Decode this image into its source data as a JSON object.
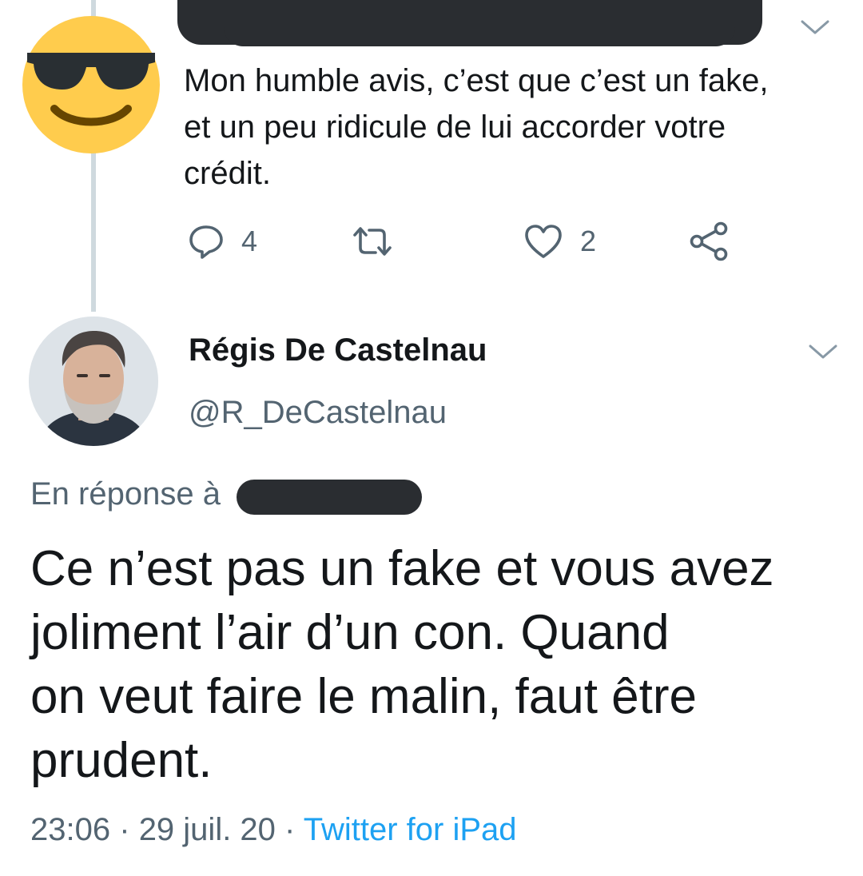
{
  "colors": {
    "text_primary": "#14171a",
    "text_secondary": "#536471",
    "link_blue": "#1da1f2",
    "thread_line": "#cfd9de",
    "redaction": "#2a2d31",
    "emoji_yellow": "#ffcc4d"
  },
  "parent_tweet": {
    "avatar_icon": "sunglasses-emoji-icon",
    "text_lines": [
      "Mon humble avis, c’est que c’est un fake,",
      "et un peu ridicule de lui accorder votre",
      "crédit."
    ],
    "actions": {
      "reply_icon": "reply-bubble-icon",
      "reply_count": "4",
      "retweet_icon": "retweet-icon",
      "like_icon": "heart-icon",
      "like_count": "2",
      "share_icon": "share-icon"
    },
    "menu_icon": "chevron-down-icon"
  },
  "main_tweet": {
    "display_name": "Régis De Castelnau",
    "handle": "@R_DeCastelnau",
    "menu_icon": "chevron-down-icon",
    "in_reply_to_label": "En réponse à",
    "text_lines": [
      "Ce n’est pas un fake et vous avez",
      "joliment l’air d’un con. Quand",
      "on veut faire le malin, faut être",
      "prudent."
    ],
    "time": "23:06",
    "separator": "·",
    "date": "29 juil. 20",
    "source": "Twitter for iPad"
  }
}
